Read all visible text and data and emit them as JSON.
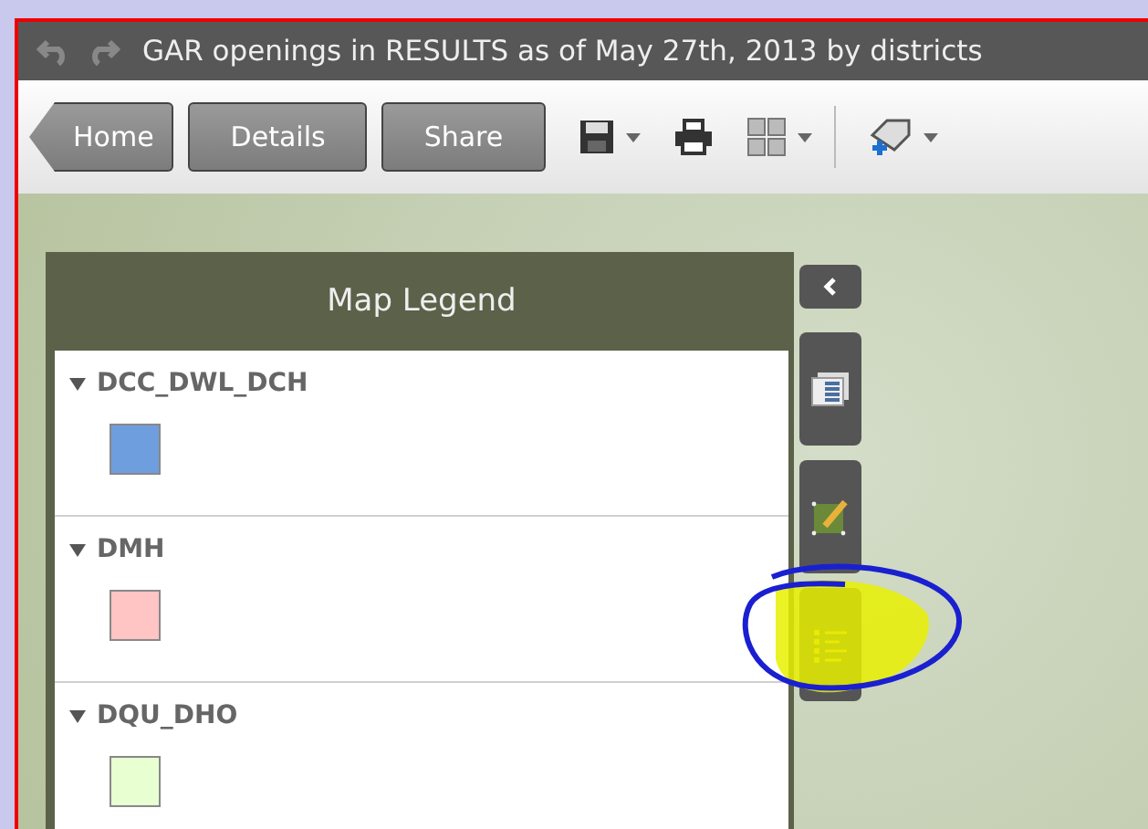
{
  "window": {
    "title": "GAR openings in RESULTS as of May 27th, 2013 by districts"
  },
  "toolbar": {
    "nav_buttons": [
      {
        "label": "Home",
        "kind": "back"
      },
      {
        "label": "Details",
        "kind": "plain"
      },
      {
        "label": "Share",
        "kind": "plain"
      }
    ]
  },
  "legend": {
    "title": "Map Legend",
    "layers": [
      {
        "name": "DCC_DWL_DCH",
        "expanded": true,
        "color": "#6f9ede"
      },
      {
        "name": "DMH",
        "expanded": true,
        "color": "#ffc4c4"
      },
      {
        "name": "DQU_DHO",
        "expanded": true,
        "color": "#e8ffd2"
      }
    ]
  },
  "side_tools": [
    {
      "kind": "table"
    },
    {
      "kind": "edit"
    },
    {
      "kind": "legend"
    }
  ]
}
